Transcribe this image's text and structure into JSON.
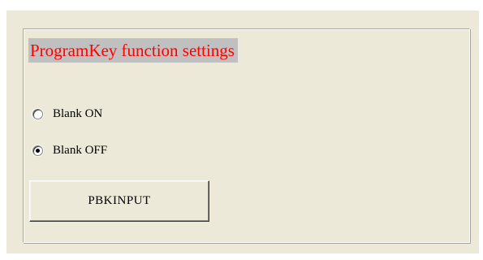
{
  "group": {
    "title": "ProgramKey function settings",
    "title_color": "#ff0000",
    "title_background": "#c0c0c0"
  },
  "options": [
    {
      "label": "Blank ON",
      "selected": false
    },
    {
      "label": "Blank OFF",
      "selected": true
    }
  ],
  "button": {
    "label": "PBKINPUT"
  },
  "colors": {
    "panel_background": "#ece9d8"
  }
}
